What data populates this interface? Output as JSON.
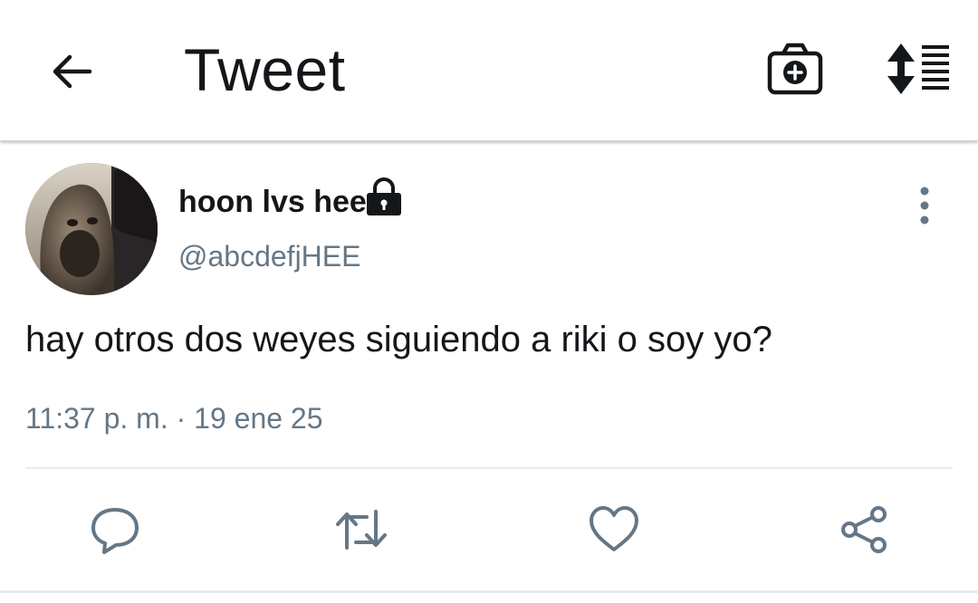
{
  "header": {
    "title": "Tweet",
    "back_icon": "arrow-left-icon",
    "camera_icon": "camera-plus-icon",
    "sort_icon": "sort-list-icon"
  },
  "tweet": {
    "user_name": "hoon lvs hee",
    "handle": "@abcdefjHEE",
    "text": "hay otros dos weyes siguiendo a riki o soy yo?",
    "timestamp": "11:37 p. m. · 19 ene 25",
    "protected": true,
    "avatar": "avatar-image"
  },
  "actions": [
    {
      "icon": "reply-icon"
    },
    {
      "icon": "retweet-icon"
    },
    {
      "icon": "heart-icon"
    },
    {
      "icon": "share-icon"
    }
  ],
  "colors": {
    "text_primary": "#14171a",
    "text_secondary": "#657786",
    "icon_gray": "#657786",
    "divider": "#e6ecf0"
  }
}
